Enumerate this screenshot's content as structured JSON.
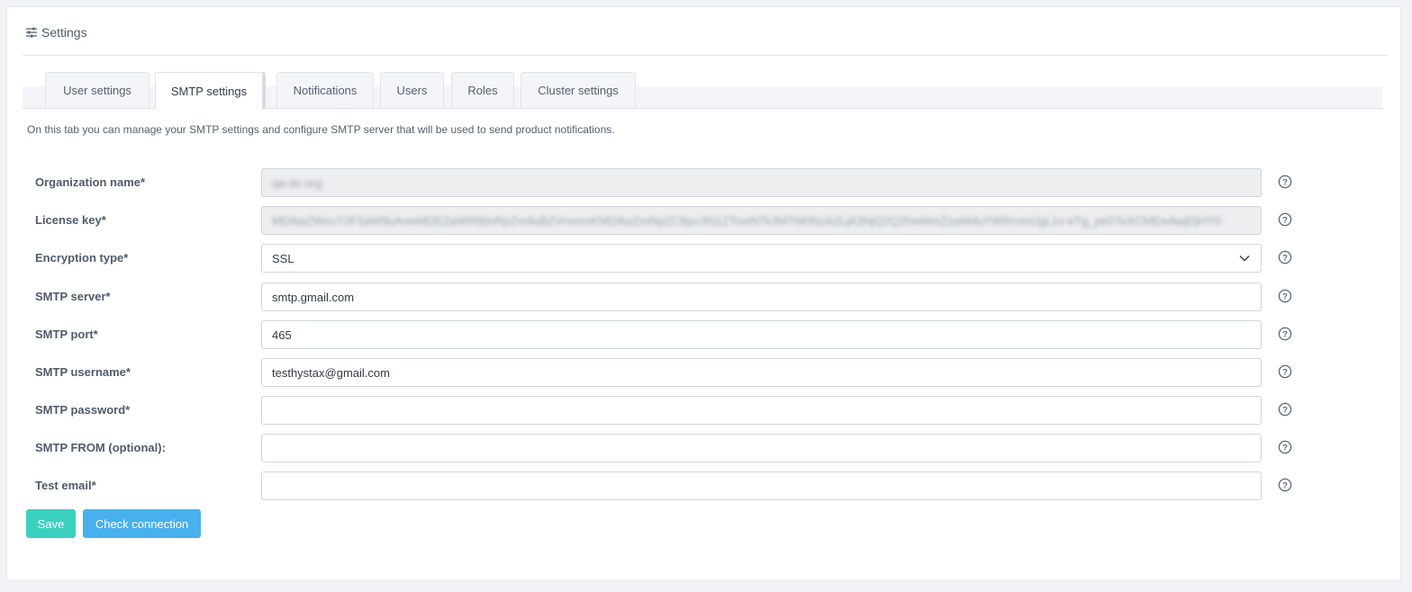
{
  "header": {
    "title": "Settings",
    "icon": "sliders-icon"
  },
  "tabs": [
    {
      "label": "User settings"
    },
    {
      "label": "SMTP settings",
      "active": true
    },
    {
      "label": "Notifications"
    },
    {
      "label": "Users"
    },
    {
      "label": "Roles"
    },
    {
      "label": "Cluster settings"
    }
  ],
  "intro": "On this tab you can manage your SMTP settings and configure SMTP server that will be used to send product notifications.",
  "form": {
    "organization_name": {
      "label": "Organization name*",
      "value": "qa-dc-org"
    },
    "license_key": {
      "label": "License key*",
      "value": "MDAwZWxvY2F5aW9uAswMDE2aWR6bnRpZm9uBZVrvonsKMDAwZmNpZCBpc3N1ZTowNTk3MTM0NzA2LjA3NjQ2Q2hwMmZzaWduYWRrvmUgL1v-eTg_pe0TeXCMEwAwjDjHY0"
    },
    "encryption_type": {
      "label": "Encryption type*",
      "value": "SSL"
    },
    "smtp_server": {
      "label": "SMTP server*",
      "value": "smtp.gmail.com"
    },
    "smtp_port": {
      "label": "SMTP port*",
      "value": "465"
    },
    "smtp_username": {
      "label": "SMTP username*",
      "value": "testhystax@gmail.com"
    },
    "smtp_password": {
      "label": "SMTP password*",
      "value": ""
    },
    "smtp_from": {
      "label": "SMTP FROM (optional):",
      "value": ""
    },
    "test_email": {
      "label": "Test email*",
      "value": ""
    }
  },
  "buttons": {
    "save": "Save",
    "check": "Check connection"
  },
  "colors": {
    "save": "#3ad0bf",
    "check": "#48b0ec"
  }
}
